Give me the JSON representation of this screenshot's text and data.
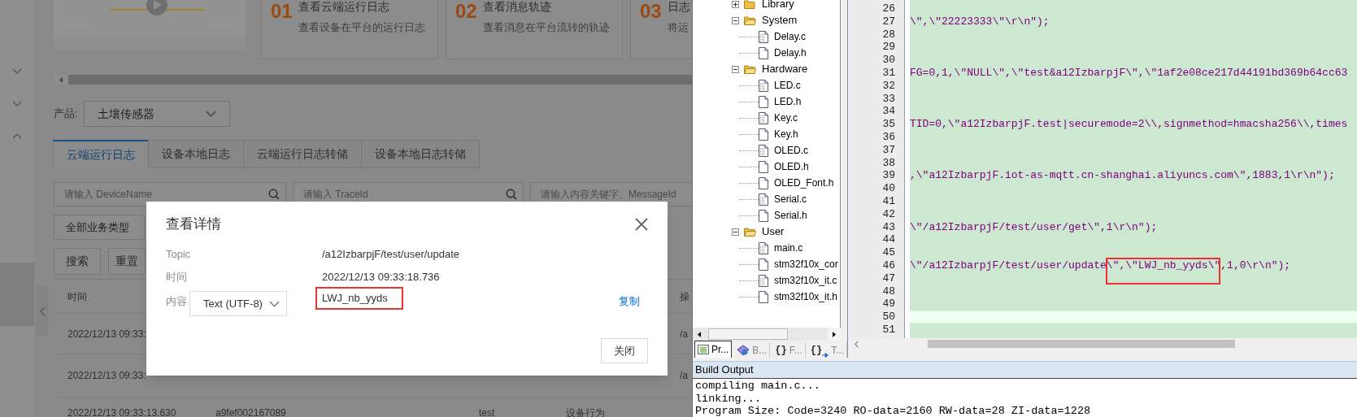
{
  "web_console": {
    "feature_cards": [
      {
        "number": "01",
        "title": "查看云端运行日志",
        "description": "查看设备在平台的运行日志"
      },
      {
        "number": "02",
        "title": "查看消息轨迹",
        "description": "查看消息在平台流转的轨迹"
      },
      {
        "number": "03",
        "title": "日志",
        "description": "将运"
      }
    ],
    "product_filter": {
      "label": "产品:",
      "value": "土壤传感器"
    },
    "tabs": [
      {
        "label": "云端运行日志",
        "selected": true
      },
      {
        "label": "设备本地日志",
        "selected": false
      },
      {
        "label": "云端运行日志转储",
        "selected": false
      },
      {
        "label": "设备本地日志转储",
        "selected": false
      }
    ],
    "search_fields": [
      {
        "placeholder": "请输入 DeviceName",
        "kind": "search"
      },
      {
        "placeholder": "请输入 TraceId",
        "kind": "search"
      },
      {
        "placeholder": "请输入内容关键字、MessageId",
        "kind": "plain"
      }
    ],
    "type_filter": {
      "value": "全部业务类型"
    },
    "buttons": [
      "搜索",
      "重置"
    ],
    "table": {
      "header": {
        "time": "时间",
        "column_5": "操"
      },
      "rows": [
        {
          "time": "2022/12/13 09:33:",
          "column_5": "/a"
        },
        {
          "time": "2022/12/13 09:33:",
          "column_5": "/a"
        },
        {
          "time": "2022/12/13 09:33:13.630",
          "column_2": "a9fef002167089",
          "column_3": "test",
          "column_4": "设备行为"
        }
      ]
    },
    "dialog": {
      "title": "查看详情",
      "fields": [
        {
          "label": "Topic",
          "value": "/a12IzbarpjF/test/user/update"
        },
        {
          "label": "时间",
          "value": "2022/12/13 09:33:18.736"
        }
      ],
      "content": {
        "label": "内容",
        "format": "Text (UTF-8)",
        "value": "LWJ_nb_yyds",
        "highlighted": true,
        "copy_link": "复制"
      },
      "close_button": "关闭"
    }
  },
  "ide": {
    "project_tree": [
      {
        "label": "Library",
        "kind": "folder",
        "expanded": false
      },
      {
        "label": "System",
        "kind": "folder",
        "expanded": true,
        "children": [
          {
            "label": "Delay.c",
            "kind": "source"
          },
          {
            "label": "Delay.h",
            "kind": "header"
          }
        ]
      },
      {
        "label": "Hardware",
        "kind": "folder",
        "expanded": true,
        "children": [
          {
            "label": "LED.c",
            "kind": "source"
          },
          {
            "label": "LED.h",
            "kind": "header"
          },
          {
            "label": "Key.c",
            "kind": "source"
          },
          {
            "label": "Key.h",
            "kind": "header"
          },
          {
            "label": "OLED.c",
            "kind": "source"
          },
          {
            "label": "OLED.h",
            "kind": "header"
          },
          {
            "label": "OLED_Font.h",
            "kind": "header"
          },
          {
            "label": "Serial.c",
            "kind": "source"
          },
          {
            "label": "Serial.h",
            "kind": "header"
          }
        ]
      },
      {
        "label": "User",
        "kind": "folder",
        "expanded": true,
        "children": [
          {
            "label": "main.c",
            "kind": "source"
          },
          {
            "label": "stm32f10x_cor",
            "kind": "header"
          },
          {
            "label": "stm32f10x_it.c",
            "kind": "source"
          },
          {
            "label": "stm32f10x_it.h",
            "kind": "header"
          }
        ]
      }
    ],
    "panel_tabs": [
      {
        "label": "Pr...",
        "kind": "project",
        "selected": true
      },
      {
        "label": "B...",
        "kind": "books",
        "selected": false
      },
      {
        "icon_text": "{}",
        "label": "F...",
        "kind": "functions",
        "selected": false
      },
      {
        "icon_text": "{}",
        "label": "T...",
        "kind": "templates",
        "selected": false
      }
    ],
    "editor": {
      "lines": [
        {
          "number": "26",
          "current": false
        },
        {
          "number": "27",
          "current": false,
          "code": "\\\",\\\"22223333\\\"\\r\\n\");"
        },
        {
          "number": "28",
          "current": false
        },
        {
          "number": "29",
          "current": false
        },
        {
          "number": "30",
          "current": false
        },
        {
          "number": "31",
          "current": false,
          "code": "FG=0,1,\\\"NULL\\\",\\\"test&a12IzbarpjF\\\",\\\"1af2e08ce217d44191bd369b64cc63"
        },
        {
          "number": "32",
          "current": false
        },
        {
          "number": "33",
          "current": false
        },
        {
          "number": "34",
          "current": false
        },
        {
          "number": "35",
          "current": false,
          "code": "TID=0,\\\"a12IzbarpjF.test|securemode=2\\\\,signmethod=hmacsha256\\\\,times"
        },
        {
          "number": "36",
          "current": false
        },
        {
          "number": "37",
          "current": false
        },
        {
          "number": "38",
          "current": false
        },
        {
          "number": "39",
          "current": false,
          "code": ",\\\"a12IzbarpjF.iot-as-mqtt.cn-shanghai.aliyuncs.com\\\",1883,1\\r\\n\");"
        },
        {
          "number": "40",
          "current": false
        },
        {
          "number": "41",
          "current": false
        },
        {
          "number": "42",
          "current": false
        },
        {
          "number": "43",
          "current": false,
          "code": "\\\"/a12IzbarpjF/test/user/get\\\",1\\r\\n\");"
        },
        {
          "number": "44",
          "current": false
        },
        {
          "number": "45",
          "current": false
        },
        {
          "number": "46",
          "current": false,
          "segments": [
            {
              "text": "\\\"/a12IzbarpjF/test/user/update",
              "highlighted": false
            },
            {
              "text": "\\\",\\\"LWJ_nb_yyds\\\"",
              "highlighted": true
            },
            {
              "text": ",1,0\\r\\n\");",
              "highlighted": false
            }
          ]
        },
        {
          "number": "47",
          "current": false
        },
        {
          "number": "48",
          "current": false
        },
        {
          "number": "49",
          "current": false
        },
        {
          "number": "50",
          "current": true
        },
        {
          "number": "51",
          "current": false
        }
      ]
    },
    "build_output": {
      "title": "Build Output",
      "lines": [
        "compiling main.c...",
        "linking...",
        "Program Size: Code=3240 RO-data=2160 RW-data=28 ZI-data=1228"
      ]
    }
  }
}
